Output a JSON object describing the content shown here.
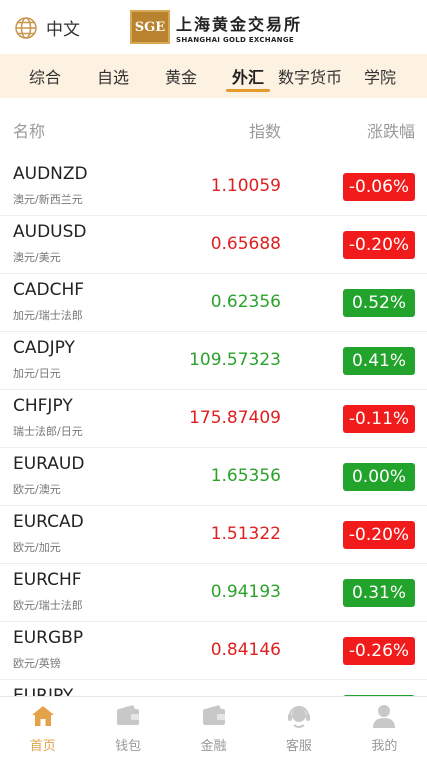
{
  "header": {
    "language_label": "中文",
    "logo_mark": "SGE",
    "logo_cn": "上海黄金交易所",
    "logo_en": "SHANGHAI GOLD EXCHANGE"
  },
  "tabs": [
    {
      "label": "综合"
    },
    {
      "label": "自选"
    },
    {
      "label": "黄金"
    },
    {
      "label": "外汇",
      "active": true
    },
    {
      "label": "数字货币"
    },
    {
      "label": "学院"
    }
  ],
  "table_header": {
    "name": "名称",
    "index": "指数",
    "change": "涨跌幅"
  },
  "rows": [
    {
      "symbol": "AUDNZD",
      "name_cn": "澳元/新西兰元",
      "price": "1.10059",
      "change": "-0.06%",
      "dir": "up"
    },
    {
      "symbol": "AUDUSD",
      "name_cn": "澳元/美元",
      "price": "0.65688",
      "change": "-0.20%",
      "dir": "up"
    },
    {
      "symbol": "CADCHF",
      "name_cn": "加元/瑞士法郎",
      "price": "0.62356",
      "change": "0.52%",
      "dir": "down"
    },
    {
      "symbol": "CADJPY",
      "name_cn": "加元/日元",
      "price": "109.57323",
      "change": "0.41%",
      "dir": "down"
    },
    {
      "symbol": "CHFJPY",
      "name_cn": "瑞士法郎/日元",
      "price": "175.87409",
      "change": "-0.11%",
      "dir": "up"
    },
    {
      "symbol": "EURAUD",
      "name_cn": "欧元/澳元",
      "price": "1.65356",
      "change": "0.00%",
      "dir": "down"
    },
    {
      "symbol": "EURCAD",
      "name_cn": "欧元/加元",
      "price": "1.51322",
      "change": "-0.20%",
      "dir": "up"
    },
    {
      "symbol": "EURCHF",
      "name_cn": "欧元/瑞士法郎",
      "price": "0.94193",
      "change": "0.31%",
      "dir": "down"
    },
    {
      "symbol": "EURGBP",
      "name_cn": "欧元/英镑",
      "price": "0.84146",
      "change": "-0.26%",
      "dir": "up"
    },
    {
      "symbol": "EURJPY",
      "name_cn": "",
      "price": "",
      "change": "",
      "dir": "down"
    }
  ],
  "colors": {
    "up": "#e02020",
    "down": "#2ba229",
    "accent": "#e5a349",
    "tab_bg": "#fdf2e2"
  },
  "bottom_nav": [
    {
      "label": "首页",
      "icon": "home-icon",
      "active": true
    },
    {
      "label": "钱包",
      "icon": "wallet-icon"
    },
    {
      "label": "金融",
      "icon": "finance-icon"
    },
    {
      "label": "客服",
      "icon": "service-icon"
    },
    {
      "label": "我的",
      "icon": "profile-icon"
    }
  ]
}
